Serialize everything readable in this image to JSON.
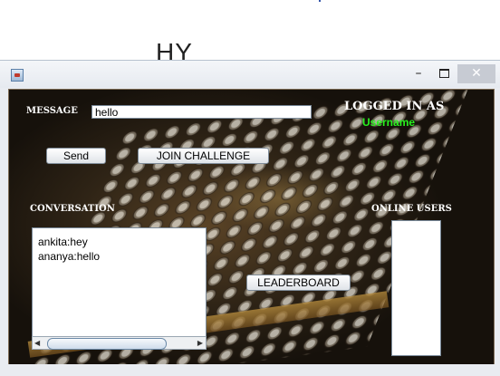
{
  "background": {
    "partial_title": "HY PERAGER"
  },
  "window": {
    "title": "",
    "controls": {
      "minimize_icon": "minimize-icon",
      "maximize_icon": "maximize-icon",
      "close_icon": "close-icon",
      "minimize": "–",
      "close": "✕"
    }
  },
  "labels": {
    "message": "MESSAGE",
    "conversation": "CONVERSATION",
    "online_users": "ONLINE USERS",
    "logged_in_as": "LOGGED IN AS",
    "username": "Username"
  },
  "message_input": {
    "value": "hello"
  },
  "buttons": {
    "send": "Send",
    "join_challenge": "JOIN CHALLENGE",
    "leaderboard": "LEADERBOARD"
  },
  "conversation": {
    "messages": [
      "ankita:hey",
      "ananya:hello"
    ]
  },
  "scrollbar": {
    "left_arrow": "◀",
    "right_arrow": "▶"
  },
  "online_users": [],
  "colors": {
    "username": "#27f21e",
    "label": "#ffffff",
    "close_hover": "#e04343"
  }
}
